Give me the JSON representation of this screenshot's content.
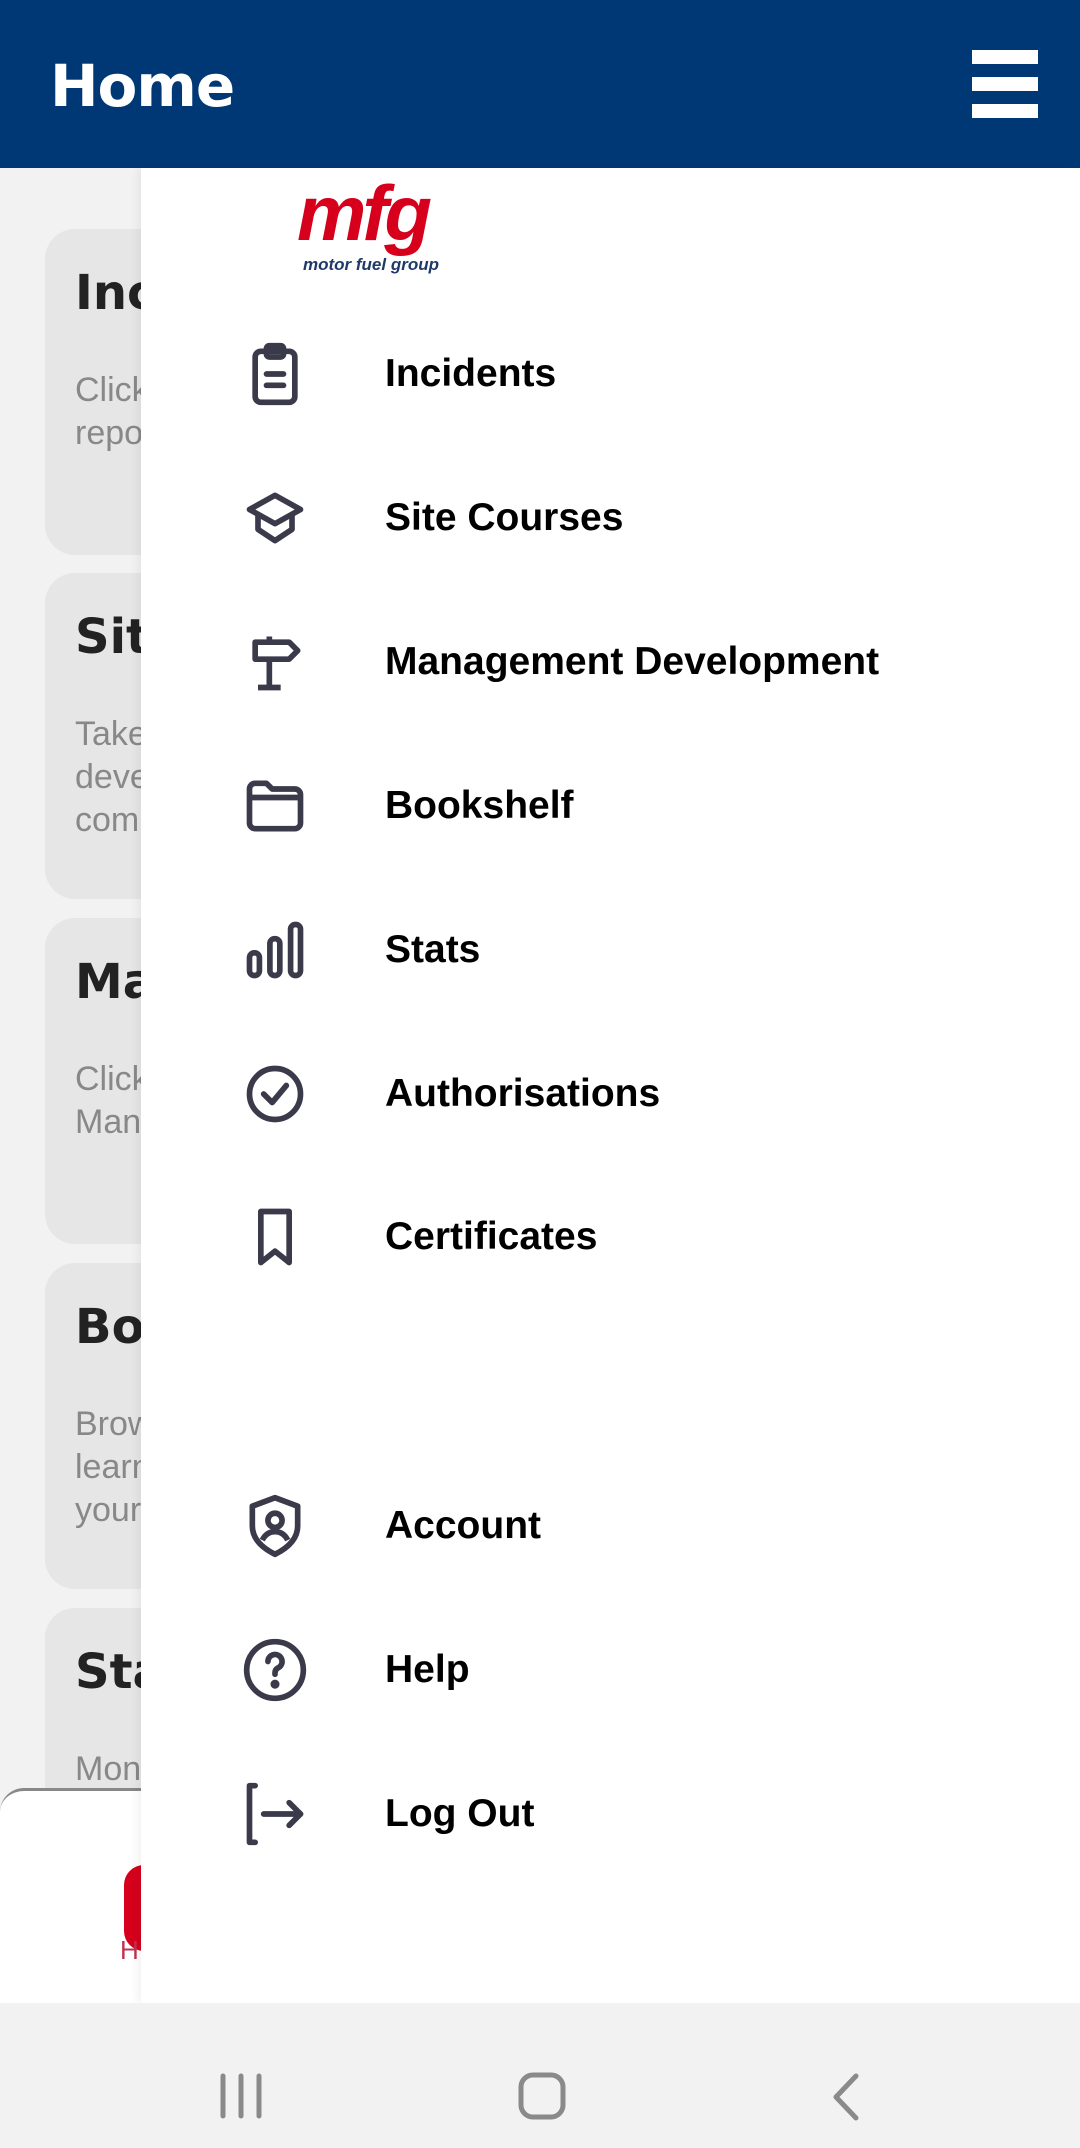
{
  "header": {
    "title": "Home",
    "menu_icon": "hamburger-icon"
  },
  "logo": {
    "text": "mfg",
    "subtext": "motor fuel group",
    "color": "#d6001c"
  },
  "background_cards": [
    {
      "title": "Inc",
      "desc": "Click\nrepo"
    },
    {
      "title": "Sit",
      "desc": "Take\ndeve\ncom"
    },
    {
      "title": "Mar",
      "desc": "Click\nMan"
    },
    {
      "title": "Bo",
      "desc": "Brow\nlearn\nyour"
    },
    {
      "title": "Sta",
      "desc": "Mon"
    }
  ],
  "tabbar": {
    "home_label": "H",
    "accent": "#d6001c"
  },
  "drawer": {
    "items": [
      {
        "label": "Incidents",
        "icon": "clipboard-icon"
      },
      {
        "label": "Site Courses",
        "icon": "graduation-cap-icon"
      },
      {
        "label": "Management Development",
        "icon": "signpost-icon"
      },
      {
        "label": "Bookshelf",
        "icon": "folder-icon"
      },
      {
        "label": "Stats",
        "icon": "bar-chart-icon"
      },
      {
        "label": "Authorisations",
        "icon": "check-circle-icon"
      },
      {
        "label": "Certificates",
        "icon": "bookmark-icon"
      },
      {
        "label": "Account",
        "icon": "user-shield-icon"
      },
      {
        "label": "Help",
        "icon": "help-circle-icon"
      },
      {
        "label": "Log Out",
        "icon": "logout-icon"
      }
    ]
  },
  "colors": {
    "header": "#003876",
    "icon": "#3a3a4a"
  }
}
